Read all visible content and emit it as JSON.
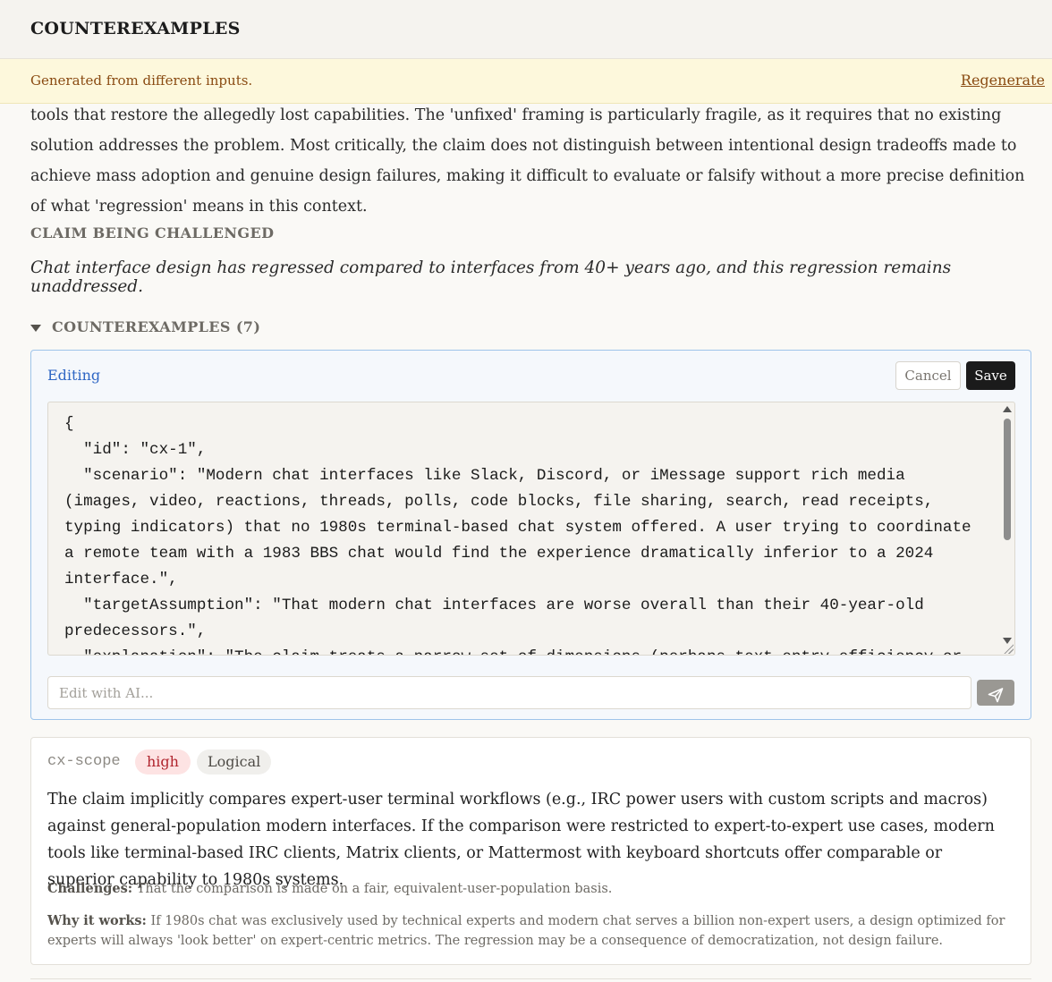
{
  "app": {
    "title": "COUNTEREXAMPLES"
  },
  "notice": {
    "message": "Generated from different inputs.",
    "regenerate_label": "Regenerate"
  },
  "summary_text": "tools that restore the allegedly lost capabilities. The 'unfixed' framing is particularly fragile, as it requires that no existing solution addresses the problem. Most critically, the claim does not distinguish between intentional design tradeoffs made to achieve mass adoption and genuine design failures, making it difficult to evaluate or falsify without a more precise definition of what 'regression' means in this context.",
  "claim": {
    "label": "CLAIM BEING CHALLENGED",
    "text": "Chat interface design has regressed compared to interfaces from 40+ years ago, and this regression remains unaddressed."
  },
  "counterexamples": {
    "header": "COUNTEREXAMPLES (7)",
    "editor": {
      "status_label": "Editing",
      "cancel_label": "Cancel",
      "save_label": "Save",
      "code": "{\n  \"id\": \"cx-1\",\n  \"scenario\": \"Modern chat interfaces like Slack, Discord, or iMessage support rich media (images, video, reactions, threads, polls, code blocks, file sharing, search, read receipts, typing indicators) that no 1980s terminal-based chat system offered. A user trying to coordinate a remote team with a 1983 BBS chat would find the experience dramatically inferior to a 2024 interface.\",\n  \"targetAssumption\": \"That modern chat interfaces are worse overall than their 40-year-old predecessors.\",\n  \"explanation\": \"The claim treats a narrow set of dimensions (perhaps text entry efficiency or",
      "ai_placeholder": "Edit with AI...",
      "send_icon": "send-icon"
    },
    "items": [
      {
        "id": "cx-scope",
        "severity": "high",
        "category": "Logical",
        "scenario": "The claim implicitly compares expert-user terminal workflows (e.g., IRC power users with custom scripts and macros) against general-population modern interfaces. If the comparison were restricted to expert-to-expert use cases, modern tools like terminal-based IRC clients, Matrix clients, or Mattermost with keyboard shortcuts offer comparable or superior capability to 1980s systems.",
        "challenges_label": "Challenges:",
        "challenges_text": "That the comparison is made on a fair, equivalent-user-population basis.",
        "why_label": "Why it works:",
        "why_text": "If 1980s chat was exclusively used by technical experts and modern chat serves a billion non-expert users, a design optimized for experts will always 'look better' on expert-centric metrics. The regression may be a consequence of democratization, not design failure."
      }
    ]
  },
  "colors": {
    "accent_blue": "#2e66c4",
    "warning_text": "#8a4b12",
    "severity_high": "#b0242d"
  }
}
